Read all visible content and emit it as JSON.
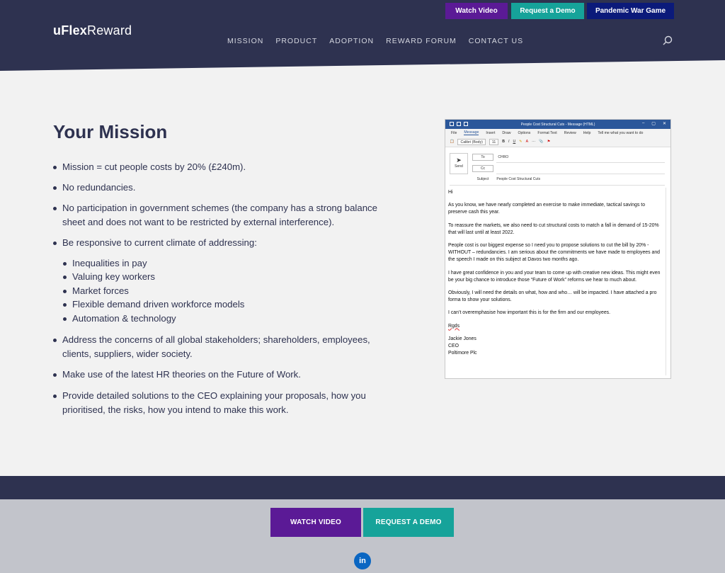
{
  "brand": {
    "name_bold": "uFlex",
    "name_regular": "Reward"
  },
  "top_buttons": [
    {
      "label": "Watch Video",
      "color": "#5b1a96"
    },
    {
      "label": "Request a Demo",
      "color": "#16a39a"
    },
    {
      "label": "Pandemic War Game",
      "color": "#0b1a7a"
    }
  ],
  "nav": [
    "MISSION",
    "PRODUCT",
    "ADOPTION",
    "REWARD FORUM",
    "CONTACT US"
  ],
  "heading": "Your Mission",
  "bullets": [
    "Mission = cut people costs by 20% (£240m).",
    "No redundancies.",
    "No participation in government schemes (the company has a strong balance sheet and does not want to be restricted by external interference).",
    "Be responsive to current climate of addressing:"
  ],
  "sub_bullets": [
    "Inequalities in pay",
    "Valuing key workers",
    "Market forces",
    "Flexible demand driven workforce models",
    "Automation & technology"
  ],
  "bullets_after": [
    "Address the concerns of all global stakeholders; shareholders, employees, clients, suppliers, wider society.",
    "Make use of the latest HR theories on the Future of Work.",
    "Provide detailed solutions to the CEO explaining your proposals, how you prioritised, the risks, how you intend to make this work."
  ],
  "email": {
    "window_title": "People Cost Structural Cuts  -  Message (HTML)",
    "ribbon_tabs": [
      "File",
      "Message",
      "Insert",
      "Draw",
      "Options",
      "Format Text",
      "Review",
      "Help",
      "Tell me what you want to do"
    ],
    "font": "Calibri (Body)",
    "font_size": "11",
    "send_label": "Send",
    "to_label": "To",
    "to_value": "CHRO",
    "cc_label": "Cc",
    "subject_label": "Subject",
    "subject_value": "People Cost Structural Cuts",
    "body": [
      "Hi",
      "As you know, we have nearly completed an exercise to make immediate, tactical savings to preserve cash this year.",
      "To reassure the markets, we also need to cut structural costs to match a fall in demand of 15-20% that will last until at least 2022.",
      "People cost is our biggest expense so I need you to propose solutions to cut the bill by 20% - WITHOUT – redundancies.  I am serious about the commitments we have made to employees and the speech I made on this subject at Davos two months ago.",
      "I have great confidence in you and your team to come up with creative new ideas.  This might even be your big chance to introduce those “Future of Work” reforms we hear to much about.",
      "Obviously, I will need the details on what, how and who… will be impacted.  I have attached a pro forma to show your solutions.",
      "I can’t overemphasise how important this is for the firm and our employees.",
      "Rgds"
    ],
    "signature": [
      "Jackie Jones",
      "CEO",
      "Poltimore Plc"
    ]
  },
  "footer_buttons": [
    {
      "label": "WATCH VIDEO",
      "color": "#5b1a96"
    },
    {
      "label": "REQUEST A DEMO",
      "color": "#16a39a"
    }
  ],
  "social": {
    "icon": "linkedin-icon",
    "label": "in"
  }
}
